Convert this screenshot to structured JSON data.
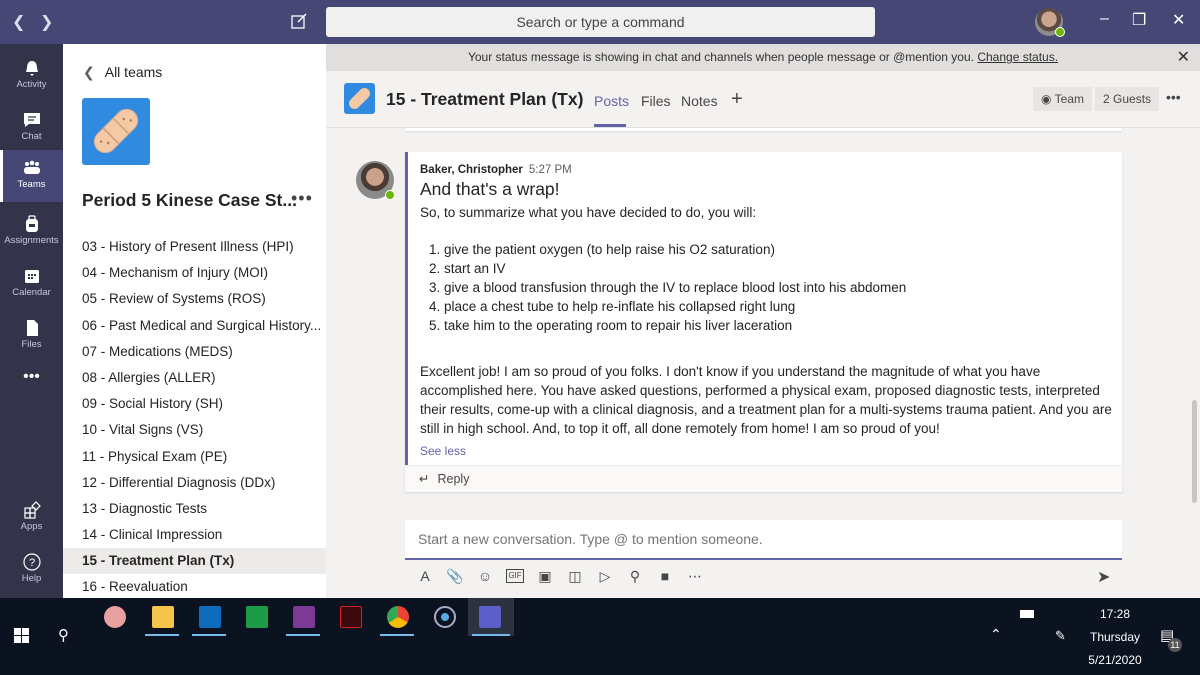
{
  "titlebar": {
    "search_placeholder": "Search or type a command",
    "back_icon": "chevron-left",
    "forward_icon": "chevron-right",
    "window_controls": [
      "minimize",
      "restore",
      "close"
    ]
  },
  "rail": {
    "items": [
      {
        "label": "Activity",
        "icon": "bell-icon"
      },
      {
        "label": "Chat",
        "icon": "chat-icon"
      },
      {
        "label": "Teams",
        "icon": "teams-icon",
        "active": true
      },
      {
        "label": "Assignments",
        "icon": "backpack-icon"
      },
      {
        "label": "Calendar",
        "icon": "calendar-icon"
      },
      {
        "label": "Files",
        "icon": "file-icon"
      },
      {
        "label": "...",
        "icon": "more-icon"
      },
      {
        "label": "Apps",
        "icon": "apps-icon"
      },
      {
        "label": "Help",
        "icon": "help-icon"
      }
    ]
  },
  "panel": {
    "back_label": "All teams",
    "team_name": "Period 5 Kinese Case St...",
    "more_label": "•••",
    "channels": [
      "03 - History of Present Illness (HPI)",
      "04 - Mechanism of Injury (MOI)",
      "05 - Review of Systems (ROS)",
      "06 - Past Medical and Surgical History...",
      "07 - Medications (MEDS)",
      "08 - Allergies (ALLER)",
      "09 - Social History (SH)",
      "10 - Vital Signs (VS)",
      "11 - Physical Exam (PE)",
      "12 - Differential Diagnosis (DDx)",
      "13 - Diagnostic Tests",
      "14 - Clinical Impression",
      "15 - Treatment Plan (Tx)",
      "16 - Reevaluation"
    ],
    "active_channel": "15 - Treatment Plan (Tx)"
  },
  "banner": {
    "text": "Your status message is showing in chat and channels when people message or @mention you.",
    "link": "Change status."
  },
  "header": {
    "channel_title": "15 - Treatment Plan (Tx)",
    "tabs": [
      "Posts",
      "Files",
      "Notes"
    ],
    "active_tab": "Posts",
    "add_tab": "+",
    "team_button": "Team",
    "guests_button": "2 Guests",
    "more": "•••"
  },
  "message": {
    "author": "Baker, Christopher",
    "time": "5:27 PM",
    "subject": "And that's a wrap!",
    "intro": "So, to summarize what you have decided to do, you will:",
    "items": [
      "give the patient oxygen (to help raise his O2 saturation)",
      "start an IV",
      "give a blood transfusion through the IV to replace blood lost into his abdomen",
      "place a chest tube to help re-inflate his collapsed right lung",
      "take him to the operating room to repair his liver laceration"
    ],
    "paragraph": "Excellent job! I am so proud of you folks. I don't know if you understand the magnitude of what you have accomplished here. You have asked questions, performed a physical exam, proposed diagnostic tests, interpreted their results, come-up with a clinical diagnosis, and a treatment plan for a multi-systems trauma patient. And you are still in high school. And, to top it off, all done remotely from home! I am so proud of you!",
    "see_less": "See less",
    "reply": "Reply"
  },
  "composer": {
    "placeholder": "Start a new conversation. Type @ to mention someone.",
    "tools": [
      "format-icon",
      "attach-icon",
      "emoji-icon",
      "gif-icon",
      "sticker-icon",
      "meet-icon",
      "stream-icon",
      "praise-icon",
      "video-icon",
      "more-icon"
    ]
  },
  "taskbar": {
    "apps": [
      "Snipping Tool",
      "File Explorer",
      "Outlook",
      "Project",
      "OneNote",
      "Acrobat",
      "Chrome",
      "Cortana",
      "Teams"
    ],
    "time": "17:28",
    "day": "Thursday",
    "date": "5/21/2020",
    "notifications": "11"
  },
  "colors": {
    "accent": "#6264a7",
    "titlebar": "#464775",
    "rail": "#33344a",
    "status_green": "#6bb700"
  }
}
